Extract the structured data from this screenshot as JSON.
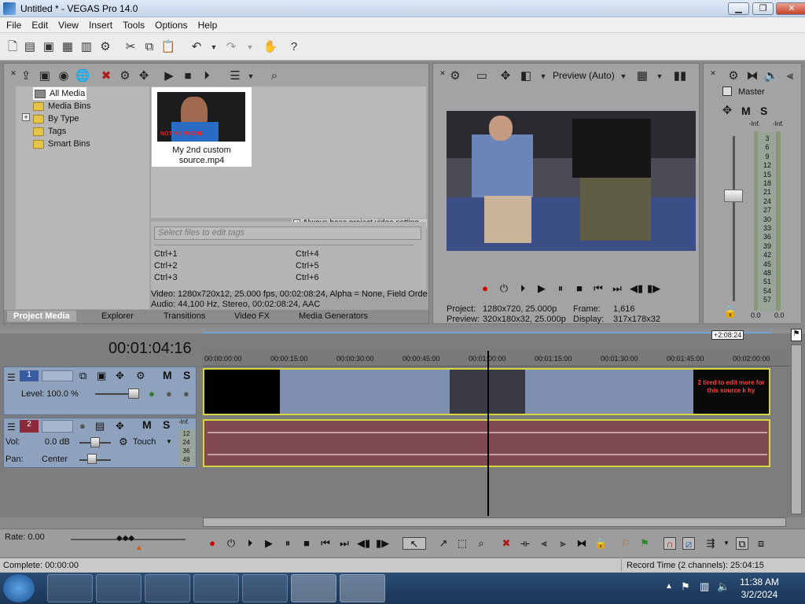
{
  "window": {
    "title": "Untitled * - VEGAS Pro 14.0",
    "minimize": "▁",
    "maximize": "❐",
    "close": "✕"
  },
  "menu": [
    "File",
    "Edit",
    "View",
    "Insert",
    "Tools",
    "Options",
    "Help"
  ],
  "project_media": {
    "tree": [
      "All Media",
      "Media Bins",
      "By Type",
      "Tags",
      "Smart Bins"
    ],
    "expand_symbol": "+",
    "thumbnail": {
      "caption_line1": "My 2nd custom",
      "caption_line2": "source.mp4",
      "overlay_text": "NOT MY PHONE"
    },
    "checkbox_label": "Always base project video setting",
    "tag_placeholder": "Select files to edit tags",
    "shortcuts": [
      "Ctrl+1",
      "Ctrl+2",
      "Ctrl+3",
      "Ctrl+4",
      "Ctrl+5",
      "Ctrl+6"
    ],
    "video_info": "Video: 1280x720x12, 25.000 fps, 00:02:08:24, Alpha = None, Field Orde",
    "audio_info": "Audio: 44,100 Hz, Stereo, 00:02:08:24, AAC",
    "tabs": [
      "Project Media",
      "Explorer",
      "Transitions",
      "Video FX",
      "Media Generators"
    ]
  },
  "preview": {
    "mode": "Preview (Auto)",
    "project_label": "Project:",
    "project_value": "1280x720, 25.000p",
    "preview_label": "Preview:",
    "preview_value": "320x180x32, 25.000p",
    "frame_label": "Frame:",
    "frame_value": "1,616",
    "display_label": "Display:",
    "display_value": "317x178x32"
  },
  "master": {
    "label": "Master",
    "m": "M",
    "s": "S",
    "left_peak": "-Inf.",
    "right_peak": "-Inf.",
    "scale": [
      "3",
      "6",
      "9",
      "12",
      "15",
      "18",
      "21",
      "24",
      "27",
      "30",
      "33",
      "36",
      "39",
      "42",
      "45",
      "48",
      "51",
      "54",
      "57"
    ],
    "readout_left": "0.0",
    "readout_right": "0.0"
  },
  "timeline": {
    "timecode": "00:01:04:16",
    "end_marker": "+2:08:24",
    "ruler": [
      "00:00:00:00",
      "00:00:15:00",
      "00:00:30:00",
      "00:00:45:00",
      "00:01:00:00",
      "00:01:15:00",
      "00:01:30:00",
      "00:01:45:00",
      "00:02:00:00"
    ],
    "video_track": {
      "number": "1",
      "m": "M",
      "s": "S",
      "level_label": "Level: 100.0 %"
    },
    "audio_track": {
      "number": "2",
      "m": "M",
      "s": "S",
      "vol_label": "Vol:",
      "vol_value": "0.0 dB",
      "pan_label": "Pan:",
      "pan_value": "Center",
      "mode": "Touch",
      "meter_top": "-Inf.",
      "meter_marks": [
        "12",
        "24",
        "36",
        "48"
      ]
    },
    "clip_overlay_text": "2 tired to edit more for this source k hy"
  },
  "transport": {
    "rate": "Rate: 0.00"
  },
  "status": {
    "complete": "Complete: 00:00:00",
    "record_time": "Record Time (2 channels): 25:04:15"
  },
  "taskbar": {
    "time": "11:38 AM",
    "date": "3/2/2024"
  }
}
